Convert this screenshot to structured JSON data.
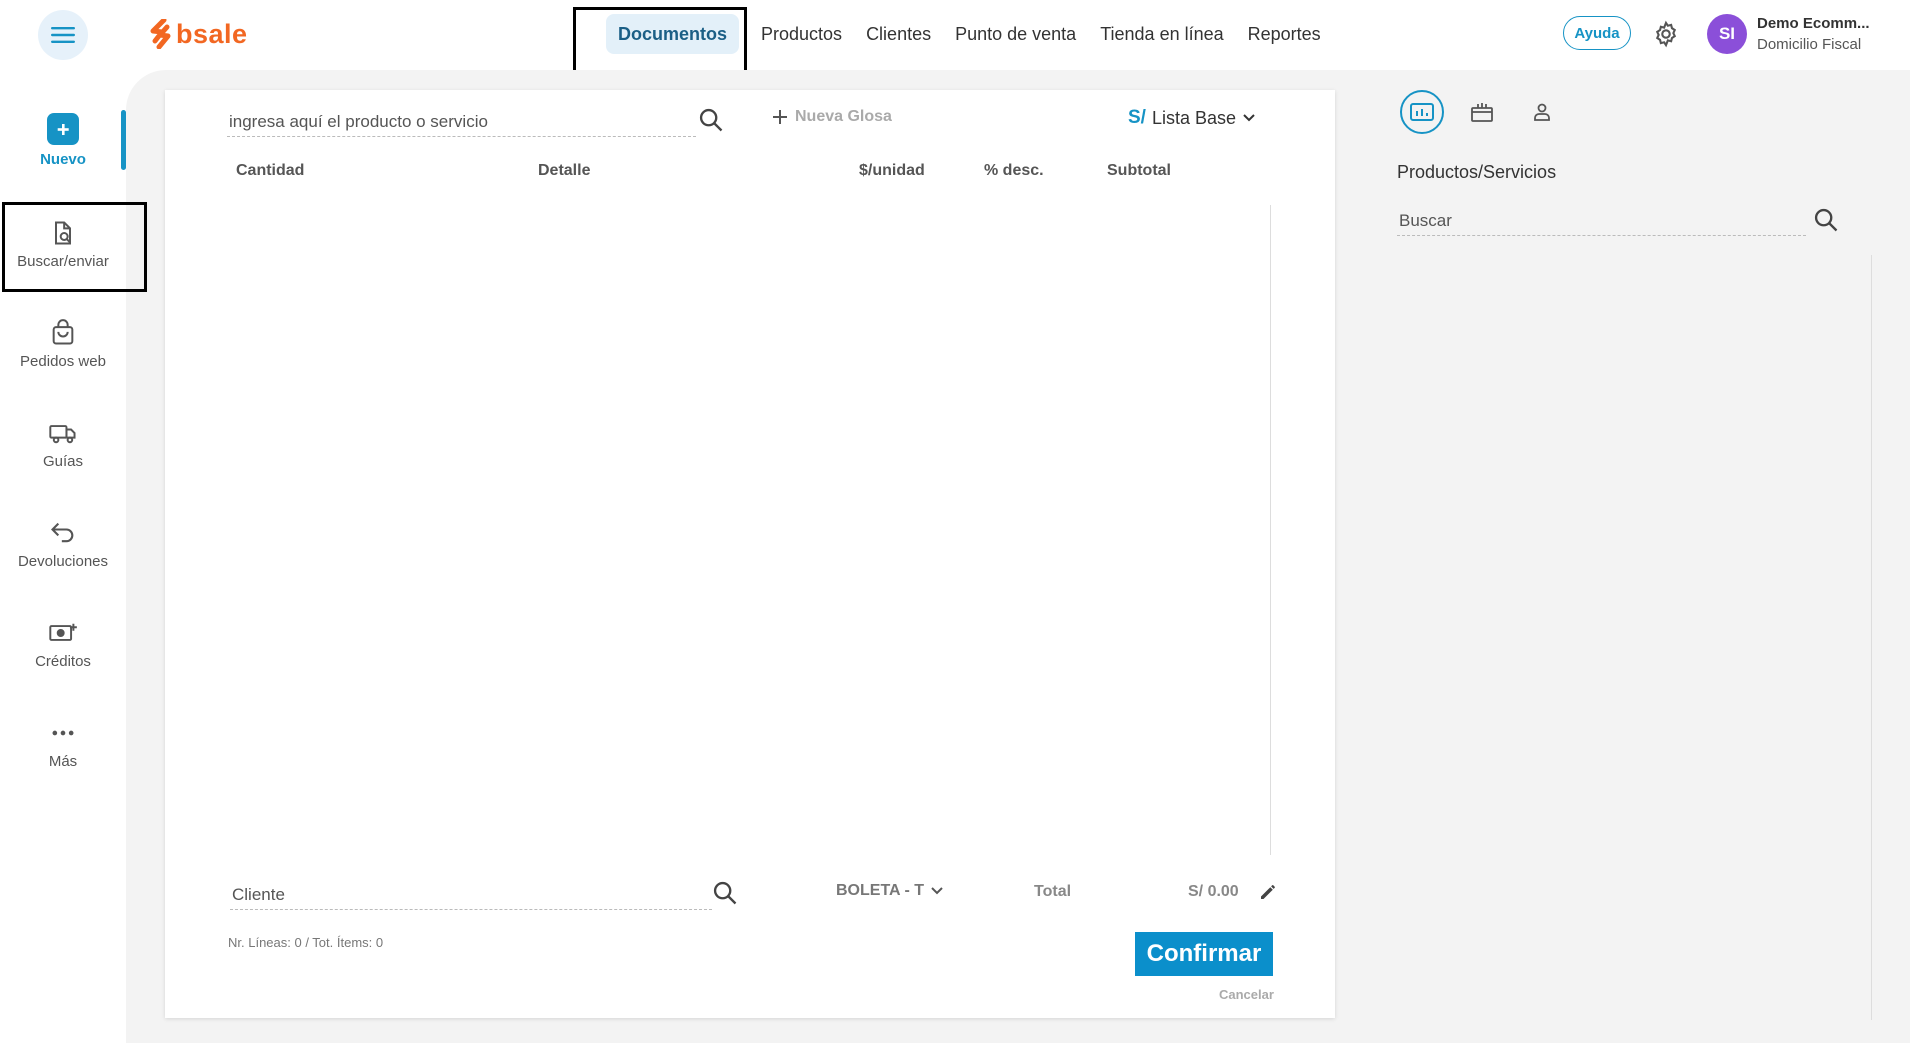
{
  "header": {
    "logo_text": "bsale",
    "nav": [
      {
        "label": "Documentos",
        "active": true
      },
      {
        "label": "Productos"
      },
      {
        "label": "Clientes"
      },
      {
        "label": "Punto de venta"
      },
      {
        "label": "Tienda en línea"
      },
      {
        "label": "Reportes"
      }
    ],
    "help_label": "Ayuda",
    "avatar_initials": "SI",
    "user_name": "Demo Ecomm...",
    "user_subtitle": "Domicilio Fiscal"
  },
  "sidebar": {
    "items": [
      {
        "label": "Nuevo",
        "icon": "new-doc-icon",
        "active": true
      },
      {
        "label": "Buscar/enviar",
        "icon": "search-doc-icon"
      },
      {
        "label": "Pedidos web",
        "icon": "shopping-bag-icon"
      },
      {
        "label": "Guías",
        "icon": "truck-icon"
      },
      {
        "label": "Devoluciones",
        "icon": "return-arrow-icon"
      },
      {
        "label": "Créditos",
        "icon": "money-plus-icon"
      },
      {
        "label": "Más",
        "icon": "more-dots-icon"
      }
    ]
  },
  "document": {
    "product_search_value": "ingresa aquí el producto o servicio",
    "new_glosa_label": "Nueva Glosa",
    "currency_symbol": "S/",
    "price_list_label": "Lista Base",
    "columns": [
      "Cantidad",
      "Detalle",
      "$/unidad",
      "% desc.",
      "Subtotal"
    ],
    "client_value": "Cliente",
    "doc_type_label": "BOLETA - T",
    "total_label": "Total",
    "total_value": "S/ 0.00",
    "counts_text": "Nr. Líneas: 0 / Tot. Ítems: 0",
    "confirm_label": "Confirmar",
    "cancel_label": "Cancelar"
  },
  "right_panel": {
    "title": "Productos/Servicios",
    "search_value": "Buscar"
  },
  "colors": {
    "accent": "#1693c5",
    "brand": "#f26722",
    "avatar": "#8b4fd9",
    "confirm": "#0b8fcb"
  }
}
